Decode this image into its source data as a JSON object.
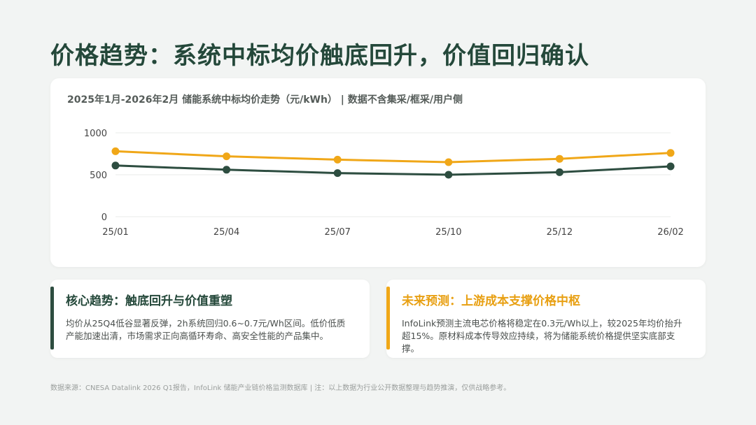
{
  "page": {
    "title": "价格趋势：系统中标均价触底回升，价值回归确认",
    "footer": "数据来源：CNESA Datalink 2026 Q1报告，InfoLink 储能产业链价格监测数据库 | 注：以上数据为行业公开数据整理与趋势推演，仅供战略参考。"
  },
  "chart_data": {
    "type": "line",
    "title": "2025年1月-2026年2月 储能系统中标均价走势（元/kWh） | 数据不含集采/框采/用户侧",
    "xlabel": "",
    "ylabel": "",
    "categories": [
      "25/01",
      "25/04",
      "25/07",
      "25/10",
      "25/12",
      "26/02"
    ],
    "y_ticks": [
      0,
      500,
      1000
    ],
    "ylim": [
      0,
      1000
    ],
    "grid": true,
    "legend": "none",
    "series": [
      {
        "values": [
          780,
          720,
          680,
          650,
          690,
          760
        ],
        "color": "#f0a718"
      },
      {
        "values": [
          610,
          560,
          520,
          500,
          530,
          600
        ],
        "color": "#2d4d40"
      }
    ]
  },
  "cards": {
    "left": {
      "heading": "核心趋势：触底回升与价值重塑",
      "body": "均价从25Q4低谷显著反弹，2h系统回归0.6~0.7元/Wh区间。低价低质产能加速出清，市场需求正向高循环寿命、高安全性能的产品集中。",
      "accent": "#2d4d40"
    },
    "right": {
      "heading": "未来预测：上游成本支撑价格中枢",
      "body": "InfoLink预测主流电芯价格将稳定在0.3元/Wh以上，较2025年均价抬升超15%。原材料成本传导效应持续，将为储能系统价格提供坚实底部支撑。",
      "accent": "#f0a718"
    }
  }
}
